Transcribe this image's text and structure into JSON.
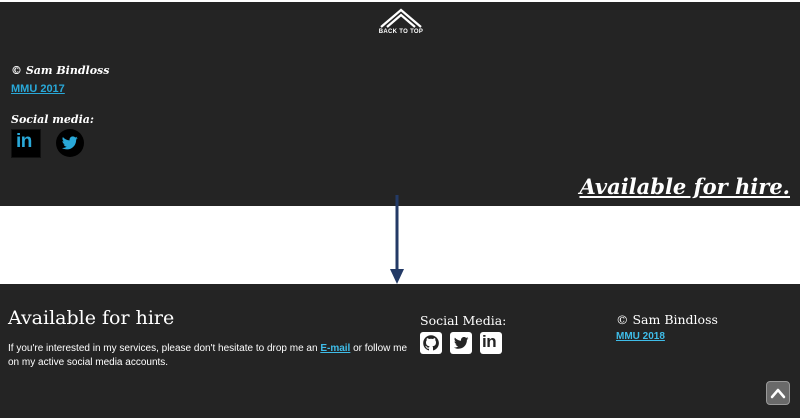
{
  "old_footer": {
    "back_to_top": {
      "label": "BACK TO TOP",
      "icon": "mountain-chevron-icon"
    },
    "copyright": "© Sam Bindloss",
    "year_link": "MMU 2017",
    "social_label": "Social media:",
    "linkedin_glyph": "in",
    "icons": [
      "linkedin-icon",
      "twitter-icon"
    ],
    "available_link": "Available for hire."
  },
  "arrow": {
    "icon": "down-arrow-icon",
    "color": "#233a66"
  },
  "new_footer": {
    "heading": "Available for hire",
    "description_before": "If you're interested in my services, please don't hesitate to drop me an ",
    "email_link": "E-mail",
    "description_after": " or follow me on my active social media accounts.",
    "social_label": "Social Media:",
    "linkedin_glyph": "in",
    "icons": [
      "github-icon",
      "twitter-icon",
      "linkedin-icon"
    ],
    "copyright": "© Sam Bindloss",
    "year_link": "MMU 2018",
    "scroll_top_icon": "chevron-up-icon"
  },
  "colors": {
    "footer_bg": "#242424",
    "link_old": "#29a8d8",
    "link_new": "#3fbde9",
    "page_bg": "#ffffff"
  }
}
